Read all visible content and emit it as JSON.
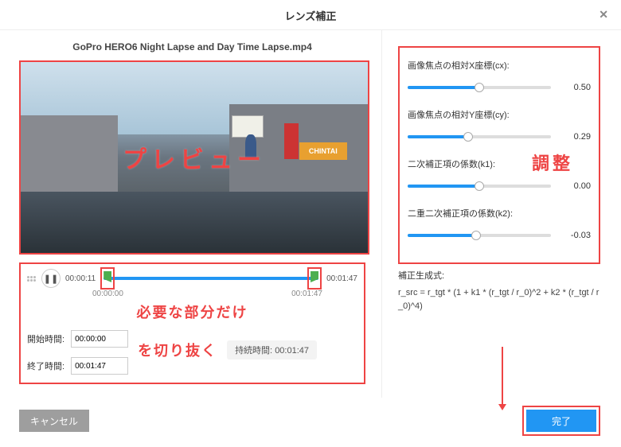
{
  "title": "レンズ補正",
  "file_name": "GoPro HERO6 Night Lapse and Day Time Lapse.mp4",
  "preview_annotation": "プレビュー",
  "sign_chintai": "CHINTAI",
  "timeline": {
    "current_time": "00:00:11",
    "start_under": "00:00:00",
    "end_time": "00:01:47",
    "end_under": "00:01:47",
    "annotation_line1": "必要な部分だけ",
    "annotation_line2": "を切り抜く",
    "start_label": "開始時間:",
    "end_label": "終了時間:",
    "start_input": "00:00:00",
    "end_input": "00:01:47",
    "duration_label": "持続時間:",
    "duration_value": "00:01:47"
  },
  "sliders": {
    "cx": {
      "label": "画像焦点の相対X座標(cx):",
      "value": "0.50",
      "pct": 50
    },
    "cy": {
      "label": "画像焦点の相対Y座標(cy):",
      "value": "0.29",
      "pct": 42
    },
    "k1": {
      "label": "二次補正項の係数(k1):",
      "value": "0.00",
      "pct": 50
    },
    "k2": {
      "label": "二重二次補正項の係数(k2):",
      "value": "-0.03",
      "pct": 48
    }
  },
  "adjust_annotation": "調整",
  "formula_label": "補正生成式:",
  "formula": "r_src = r_tgt * (1 + k1 * (r_tgt / r_0)^2 + k2 * (r_tgt / r_0)^4)",
  "buttons": {
    "cancel": "キャンセル",
    "done": "完了"
  }
}
